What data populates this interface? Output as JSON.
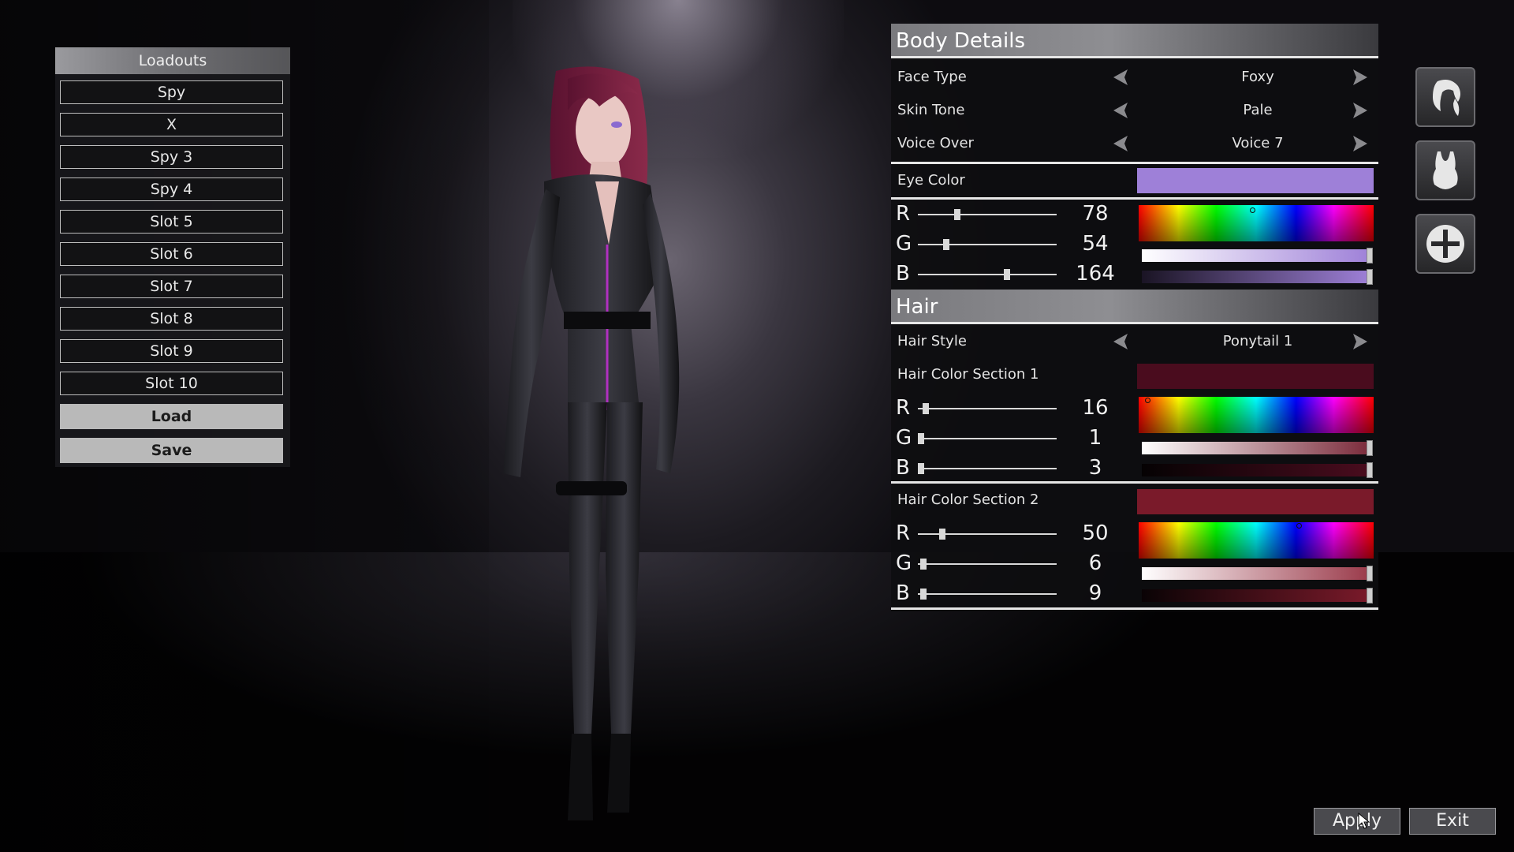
{
  "loadouts": {
    "header": "Loadouts",
    "slots": [
      "Spy",
      "X",
      "Spy 3",
      "Spy 4",
      "Slot 5",
      "Slot 6",
      "Slot 7",
      "Slot 8",
      "Slot 9",
      "Slot 10"
    ],
    "load_label": "Load",
    "save_label": "Save"
  },
  "body_details": {
    "title": "Body Details",
    "face_type": {
      "label": "Face Type",
      "value": "Foxy"
    },
    "skin_tone": {
      "label": "Skin Tone",
      "value": "Pale"
    },
    "voice_over": {
      "label": "Voice Over",
      "value": "Voice 7"
    },
    "eye_color": {
      "label": "Eye Color",
      "swatch_color": "#9e80d8",
      "r_label": "R",
      "g_label": "G",
      "b_label": "B",
      "r": "78",
      "g": "54",
      "b": "164"
    }
  },
  "hair": {
    "title": "Hair",
    "hair_style": {
      "label": "Hair Style",
      "value": "Ponytail 1"
    },
    "section1": {
      "label": "Hair Color Section 1",
      "swatch_color": "#4a0c1e",
      "r_label": "R",
      "g_label": "G",
      "b_label": "B",
      "r": "16",
      "g": "1",
      "b": "3"
    },
    "section2": {
      "label": "Hair Color Section 2",
      "swatch_color": "#7a1a2a",
      "r_label": "R",
      "g_label": "G",
      "b_label": "B",
      "r": "50",
      "g": "6",
      "b": "9"
    }
  },
  "side_icons": [
    "hair-icon",
    "outfit-icon",
    "add-icon"
  ],
  "buttons": {
    "apply": "Apply",
    "exit": "Exit"
  }
}
